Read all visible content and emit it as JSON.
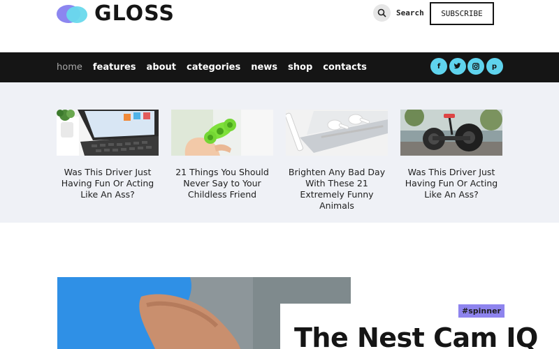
{
  "header": {
    "logo_text": "GLOSS",
    "search_label": "Search",
    "subscribe_label": "SUBSCRIBE"
  },
  "nav": {
    "items": [
      "home",
      "features",
      "about",
      "categories",
      "news",
      "shop",
      "contacts"
    ],
    "active": "home",
    "social_icons": [
      "facebook-icon",
      "twitter-icon",
      "instagram-icon",
      "pinterest-icon"
    ],
    "social_glyphs": [
      "f",
      "t",
      "◎",
      "p"
    ]
  },
  "featured": [
    {
      "title": "Was This Driver Just Having Fun Or Acting Like An Ass?"
    },
    {
      "title": "21 Things You Should Never Say to Your Childless Friend"
    },
    {
      "title": "Brighten Any Bad Day With These 21 Extremely Funny Animals"
    },
    {
      "title": "Was This Driver Just Having Fun Or Acting Like An Ass?"
    }
  ],
  "hero": {
    "tag": "#spinner",
    "title": "The Nest Cam IQ"
  },
  "colors": {
    "nav_bg": "#151515",
    "strip_bg": "#eff1f6",
    "social_accent": "#5fd3ed",
    "tag_accent": "#8e84ee"
  }
}
